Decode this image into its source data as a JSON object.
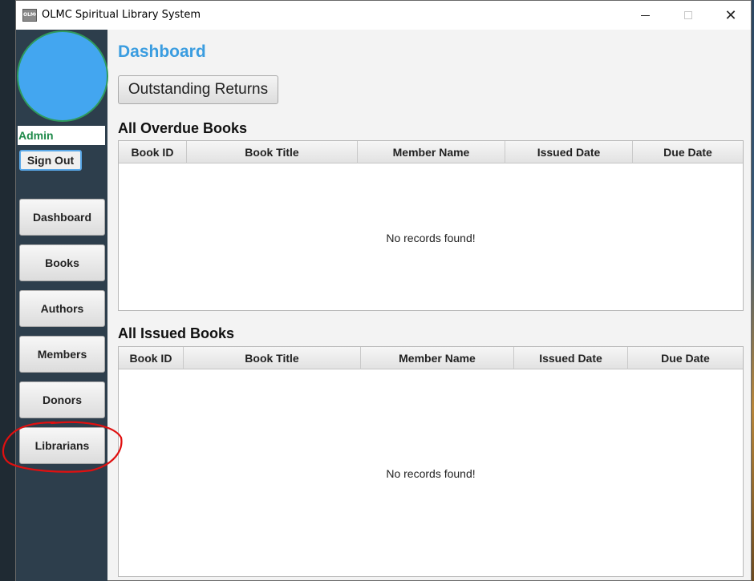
{
  "window": {
    "icon_text": "OLMC",
    "title": "OLMC Spiritual Library System",
    "controls": {
      "minimize": "minimize",
      "maximize": "maximize",
      "close": "✕"
    }
  },
  "sidebar": {
    "user": "Admin",
    "sign_out": "Sign Out",
    "nav": [
      {
        "label": "Dashboard"
      },
      {
        "label": "Books"
      },
      {
        "label": "Authors"
      },
      {
        "label": "Members"
      },
      {
        "label": "Donors"
      },
      {
        "label": "Librarians"
      }
    ]
  },
  "main": {
    "title": "Dashboard",
    "outstanding_button": "Outstanding Returns",
    "overdue": {
      "heading": "All Overdue Books",
      "columns": [
        "Book ID",
        "Book Title",
        "Member Name",
        "Issued Date",
        "Due Date"
      ],
      "rows": [],
      "empty_text": "No records found!"
    },
    "issued": {
      "heading": "All Issued Books",
      "columns": [
        "Book ID",
        "Book Title",
        "Member Name",
        "Issued Date",
        "Due Date"
      ],
      "rows": [],
      "empty_text": "No records found!"
    }
  },
  "colors": {
    "sidebar_bg": "#2d3e4c",
    "avatar": "#43a6f0",
    "accent_title": "#3b9de0",
    "user_name": "#1f8a4a",
    "annotation": "#e01010"
  }
}
